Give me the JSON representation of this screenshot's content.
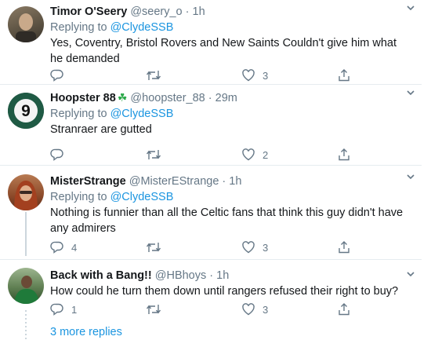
{
  "tweets": [
    {
      "name": "Timor O'Seery",
      "handle": "@seery_o",
      "time": "1h",
      "reply_prefix": "Replying to ",
      "reply_to": "@ClydeSSB",
      "text": "Yes, Coventry, Bristol Rovers and New Saints Couldn't give him what he demanded",
      "replies": "",
      "retweets": "",
      "likes": "3",
      "avatar_icon": "profile-photo"
    },
    {
      "name": "Hoopster 88",
      "name_emoji": "☘",
      "handle": "@hoopster_88",
      "time": "29m",
      "reply_prefix": "Replying to ",
      "reply_to": "@ClydeSSB",
      "text": "Stranraer are gutted",
      "replies": "",
      "retweets": "",
      "likes": "2",
      "avatar_icon": "pool-ball-nine",
      "avatar_glyph": "9"
    },
    {
      "name": "MisterStrange",
      "handle": "@MisterEStrange",
      "time": "1h",
      "reply_prefix": "Replying to ",
      "reply_to": "@ClydeSSB",
      "text": "Nothing is funnier than all the Celtic fans that think this guy didn't have any admirers",
      "replies": "4",
      "retweets": "",
      "likes": "3",
      "avatar_icon": "profile-photo"
    },
    {
      "name": "Back with a Bang!!",
      "handle": "@HBhoys",
      "time": "1h",
      "text": "How could he turn them down until rangers refused their right to buy?",
      "replies": "1",
      "retweets": "",
      "likes": "3",
      "avatar_icon": "profile-photo"
    }
  ],
  "more_replies": "3 more replies",
  "dot": "·",
  "icons": [
    "reply-icon",
    "retweet-icon",
    "like-icon",
    "share-icon",
    "chevron-down-icon"
  ],
  "colors": {
    "link": "#1b95e0",
    "muted": "#657786",
    "divider": "#e6ecf0",
    "clover": "#2ca94a"
  }
}
